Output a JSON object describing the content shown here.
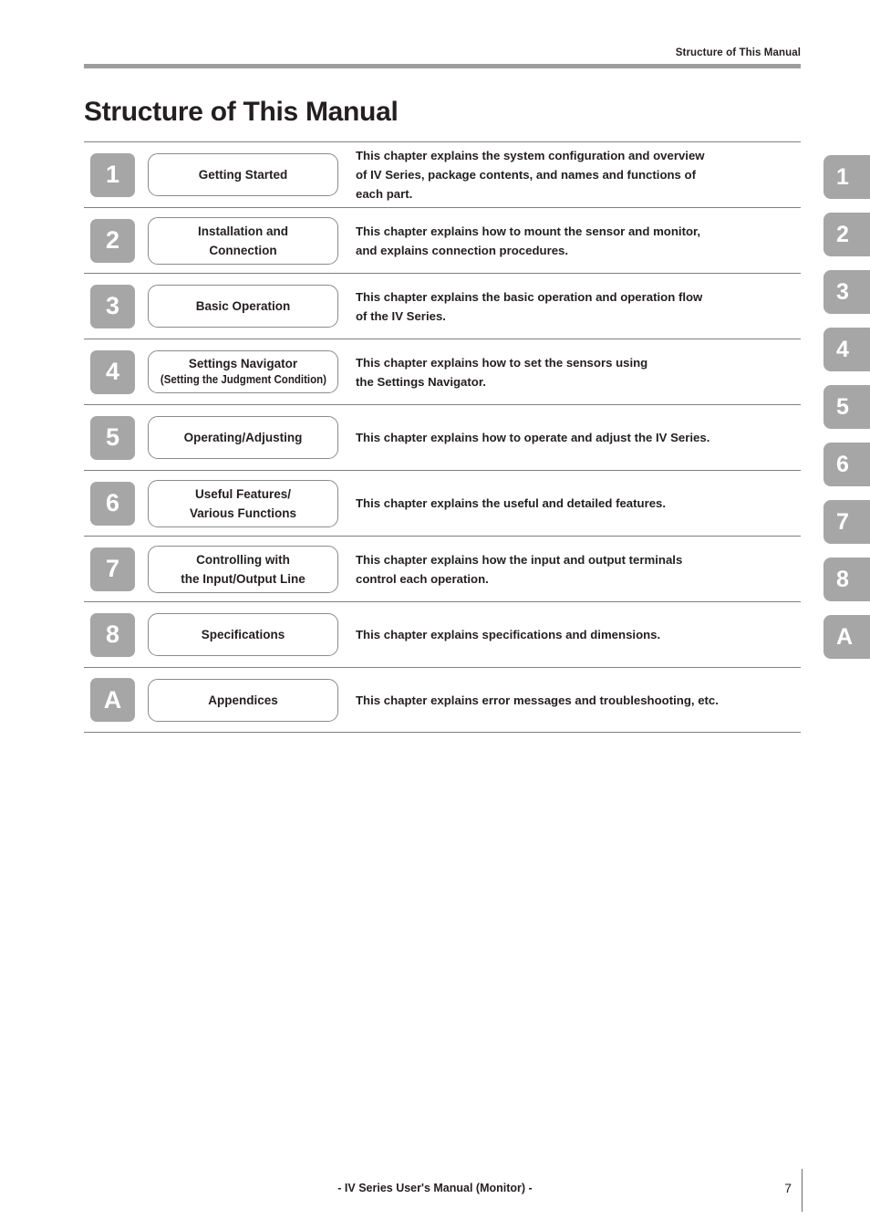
{
  "header": {
    "running_title": "Structure of This Manual",
    "page_title": "Structure of This Manual"
  },
  "chapters": [
    {
      "number": "1",
      "title_lines": [
        "Getting Started"
      ],
      "sub_title": "",
      "description_lines": [
        "This chapter explains the system configuration and overview",
        "of IV Series, package contents, and names and functions of",
        "each part."
      ]
    },
    {
      "number": "2",
      "title_lines": [
        "Installation and",
        "Connection"
      ],
      "sub_title": "",
      "description_lines": [
        "This chapter explains how to mount the sensor and monitor,",
        "and explains connection procedures."
      ]
    },
    {
      "number": "3",
      "title_lines": [
        "Basic Operation"
      ],
      "sub_title": "",
      "description_lines": [
        "This chapter explains the basic operation and operation flow",
        "of the IV Series."
      ]
    },
    {
      "number": "4",
      "title_lines": [
        "Settings Navigator"
      ],
      "sub_title": "(Setting the Judgment Condition)",
      "description_lines": [
        "This chapter explains how to set the sensors using",
        "the Settings Navigator."
      ]
    },
    {
      "number": "5",
      "title_lines": [
        "Operating/Adjusting"
      ],
      "sub_title": "",
      "description_lines": [
        "This chapter explains how to operate and adjust the IV Series."
      ]
    },
    {
      "number": "6",
      "title_lines": [
        "Useful Features/",
        "Various Functions"
      ],
      "sub_title": "",
      "description_lines": [
        "This chapter explains the useful and detailed features."
      ]
    },
    {
      "number": "7",
      "title_lines": [
        "Controlling with",
        "the Input/Output Line"
      ],
      "sub_title": "",
      "description_lines": [
        "This chapter explains how the input and output terminals",
        "control each operation."
      ]
    },
    {
      "number": "8",
      "title_lines": [
        "Specifications"
      ],
      "sub_title": "",
      "description_lines": [
        "This chapter explains specifications and dimensions."
      ]
    },
    {
      "number": "A",
      "title_lines": [
        "Appendices"
      ],
      "sub_title": "",
      "description_lines": [
        "This chapter explains error messages and troubleshooting, etc."
      ]
    }
  ],
  "side_tabs": [
    "1",
    "2",
    "3",
    "4",
    "5",
    "6",
    "7",
    "8",
    "A"
  ],
  "footer": {
    "text": "- IV Series User's Manual (Monitor) -",
    "page_number": "7"
  },
  "colors": {
    "chapter_block": "#a6a6a6",
    "header_rule": "#9d9d9d",
    "text": "#231f20",
    "box_border": "#8a8a8a",
    "separator": "#808080"
  }
}
